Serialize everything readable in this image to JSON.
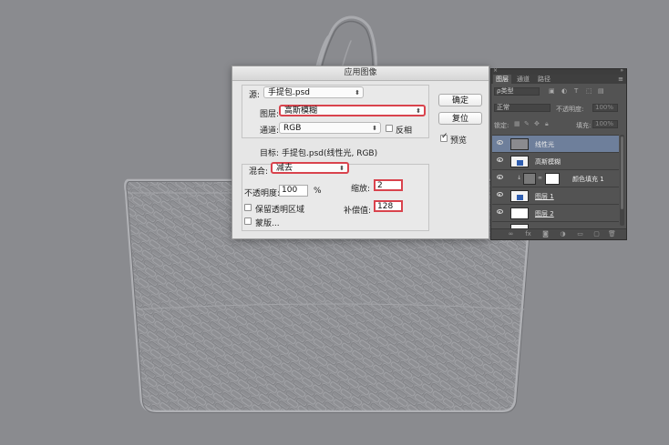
{
  "dialog": {
    "title": "应用图像",
    "source_label": "源:",
    "source_value": "手提包.psd",
    "layer_label": "图层:",
    "layer_value": "高斯模糊",
    "channel_label": "通道:",
    "channel_value": "RGB",
    "invert_label": "反相",
    "invert_checked": false,
    "target_label": "目标:",
    "target_value": "手提包.psd(线性光, RGB)",
    "blending_label": "混合:",
    "blending_value": "减去",
    "opacity_label": "不透明度:",
    "opacity_value": "100",
    "opacity_unit": "%",
    "scale_label": "缩放:",
    "scale_value": "2",
    "offset_label": "补偿值:",
    "offset_value": "128",
    "preserve_transparency_label": "保留透明区域",
    "mask_label": "蒙版...",
    "ok_label": "确定",
    "reset_label": "复位",
    "preview_label": "预览",
    "preview_checked": true,
    "highlight_color": "#d9434d"
  },
  "layers_panel": {
    "tabs": [
      "图层",
      "通道",
      "路径"
    ],
    "active_tab": "图层",
    "filter_label": "ρ类型",
    "blend_mode": "正常",
    "opacity_label": "不透明度:",
    "opacity_value": "100%",
    "lock_label": "锁定:",
    "fill_label": "填充:",
    "fill_value": "100%",
    "layers": [
      {
        "name": "线性光",
        "thumb": "gray",
        "active": true
      },
      {
        "name": "高斯模糊",
        "thumb": "bag",
        "active": false
      },
      {
        "name": "颜色填充 1",
        "thumb": "fill",
        "active": false
      },
      {
        "name": "图层 1",
        "thumb": "bag",
        "active": false
      },
      {
        "name": "图层 2",
        "thumb": "white",
        "active": false
      }
    ],
    "bottom_icons": [
      "link-icon",
      "fx-icon",
      "mask-icon",
      "adjustment-icon",
      "folder-icon",
      "new-layer-icon",
      "trash-icon"
    ]
  }
}
